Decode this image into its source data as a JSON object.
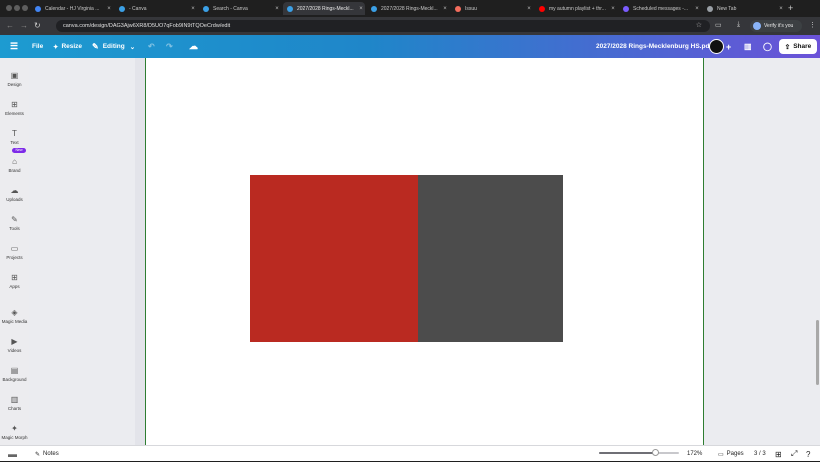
{
  "browser": {
    "tabs": [
      {
        "title": "Calendar - HJ Virginia ...",
        "favicon_color": "#4285f4",
        "active": false
      },
      {
        "title": "- Canva",
        "favicon_color": "#3ba0e6",
        "active": false
      },
      {
        "title": "Search - Canva",
        "favicon_color": "#3ba0e6",
        "active": false
      },
      {
        "title": "2027/2028 Rings-Meckl...",
        "favicon_color": "#3ba0e6",
        "active": true
      },
      {
        "title": "2027/2028 Rings-Meckl...",
        "favicon_color": "#3ba0e6",
        "active": false
      },
      {
        "title": "Issuu",
        "favicon_color": "#f36d5d",
        "active": false
      },
      {
        "title": "my autumn playlist + thr...",
        "favicon_color": "#ff0000",
        "active": false
      },
      {
        "title": "Scheduled messages -...",
        "favicon_color": "#7b5cff",
        "active": false
      },
      {
        "title": "New Tab",
        "favicon_color": "#9aa0a6",
        "active": false
      }
    ],
    "tab_close_glyph": "×",
    "new_tab_glyph": "+",
    "url": "canva.com/design/DAG3Ajw6XR8/D5UO7qFob9IN9tTQOeCrdw/edit",
    "verify_label": "Verify it's you"
  },
  "canva": {
    "file_label": "File",
    "resize_label": "Resize",
    "editing_label": "Editing",
    "doc_title": "2027/2028 Rings-Mecklenburg HS.pdf",
    "share_label": "Share",
    "sidebar": [
      {
        "label": "Design",
        "icon": "design-icon",
        "glyph": "▣"
      },
      {
        "label": "Elements",
        "icon": "elements-icon",
        "glyph": "⊞"
      },
      {
        "label": "Text",
        "icon": "text-icon",
        "glyph": "T"
      },
      {
        "label": "Brand",
        "icon": "brand-icon",
        "glyph": "⌂"
      },
      {
        "label": "Uploads",
        "icon": "uploads-icon",
        "glyph": "☁"
      },
      {
        "label": "Tools",
        "icon": "tools-icon",
        "glyph": "✎"
      },
      {
        "label": "Projects",
        "icon": "projects-icon",
        "glyph": "▭"
      },
      {
        "label": "Apps",
        "icon": "apps-icon",
        "glyph": "⊞"
      },
      {
        "label": "Magic Media",
        "icon": "magic-media-icon",
        "glyph": "◈"
      },
      {
        "label": "Videos",
        "icon": "videos-icon",
        "glyph": "▶"
      },
      {
        "label": "Background",
        "icon": "background-icon",
        "glyph": "▤"
      },
      {
        "label": "Charts",
        "icon": "charts-icon",
        "glyph": "▥"
      },
      {
        "label": "Magic Morph",
        "icon": "magic-morph-icon",
        "glyph": "✦"
      }
    ],
    "new_badge": "New",
    "footer": {
      "notes_label": "Notes",
      "zoom": "172%",
      "zoom_fraction": 0.7,
      "pages_label": "Pages",
      "page_counter": "3 / 3"
    },
    "colors": {
      "red_block": "#ba2a21",
      "grey_block": "#4c4c4c"
    }
  }
}
